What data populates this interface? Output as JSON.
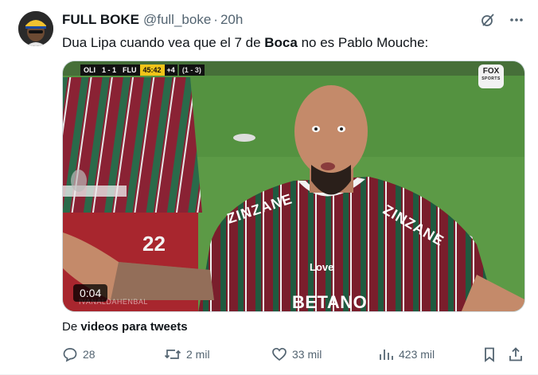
{
  "author": {
    "display_name": "FULL BOKE",
    "handle": "@full_boke",
    "separator": "·",
    "time": "20h"
  },
  "post": {
    "text_before": "Dua Lipa cuando vea que el 7 de ",
    "text_bold": "Boca",
    "text_after": " no es Pablo Mouche:"
  },
  "video": {
    "duration": "0:04",
    "scorebug": {
      "home": "OLI",
      "score": "1 - 1",
      "away": "FLU",
      "clock": "45:42",
      "added": "+4",
      "aggregate": "(1 - 3)"
    },
    "broadcaster": {
      "name": "FOX",
      "sub": "SPORTS"
    },
    "jersey_left": "ZINZANE",
    "jersey_right": "ZINZANE",
    "jersey_sponsor": "BETANO",
    "jersey_love": "Love",
    "watermark": "IVANALDAHENBAL",
    "colors": {
      "grass": "#5c9a46",
      "garnet": "#7a1e2c",
      "green": "#1f5a3f",
      "skin": "#c48a6a"
    }
  },
  "source": {
    "prefix": "De ",
    "link": "videos para tweets"
  },
  "actions": {
    "replies": "28",
    "reposts": "2 mil",
    "likes": "33 mil",
    "views": "423 mil"
  },
  "icons": {
    "grok": "grok-icon",
    "more": "more-icon",
    "reply": "reply-icon",
    "repost": "repost-icon",
    "like": "heart-icon",
    "views": "views-icon",
    "bookmark": "bookmark-icon",
    "share": "share-icon"
  }
}
